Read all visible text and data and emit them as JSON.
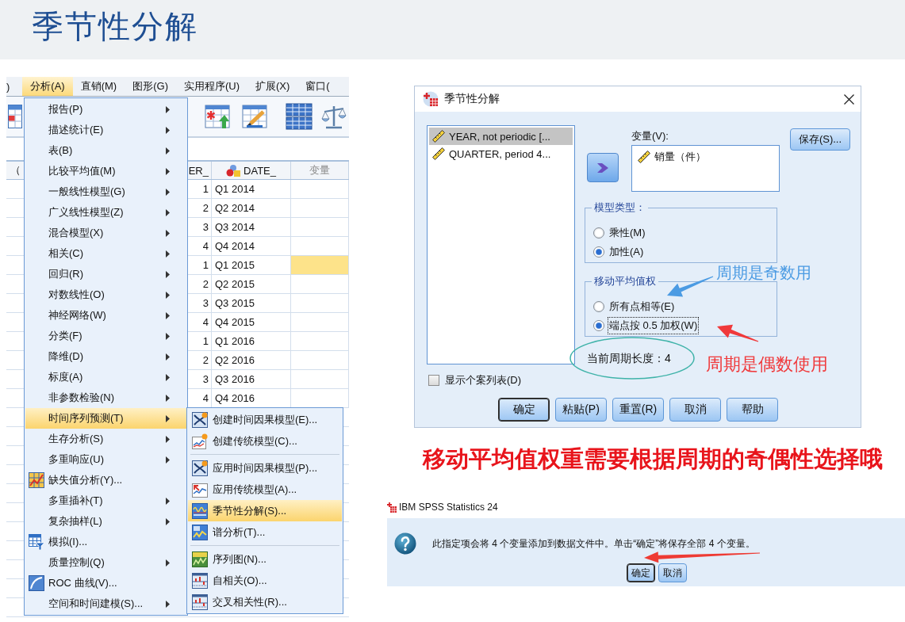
{
  "slide_title": "季节性分解",
  "spss_window": {
    "menu_bar": [
      {
        "label": ")",
        "selected": false
      },
      {
        "label": "分析(A)",
        "selected": true
      },
      {
        "label": "直销(M)",
        "selected": false
      },
      {
        "label": "图形(G)",
        "selected": false
      },
      {
        "label": "实用程序(U)",
        "selected": false
      },
      {
        "label": "扩展(X)",
        "selected": false
      },
      {
        "label": "窗口(",
        "selected": false
      }
    ],
    "grid": {
      "columns": [
        {
          "label": "（",
          "kind": "plain"
        },
        {
          "label": "ER_",
          "kind": "plain"
        },
        {
          "label": "DATE_",
          "kind": "nominal"
        },
        {
          "label": "变量",
          "kind": "empty"
        }
      ],
      "rows": [
        {
          "number": "1",
          "date": "Q1 2014",
          "selected": false
        },
        {
          "number": "2",
          "date": "Q2 2014",
          "selected": false
        },
        {
          "number": "3",
          "date": "Q3 2014",
          "selected": false
        },
        {
          "number": "4",
          "date": "Q4 2014",
          "selected": false
        },
        {
          "number": "1",
          "date": "Q1 2015",
          "selected": true
        },
        {
          "number": "2",
          "date": "Q2 2015",
          "selected": false
        },
        {
          "number": "3",
          "date": "Q3 2015",
          "selected": false
        },
        {
          "number": "4",
          "date": "Q4 2015",
          "selected": false
        },
        {
          "number": "1",
          "date": "Q1 2016",
          "selected": false
        },
        {
          "number": "2",
          "date": "Q2 2016",
          "selected": false
        },
        {
          "number": "3",
          "date": "Q3 2016",
          "selected": false
        },
        {
          "number": "4",
          "date": "Q4 2016",
          "selected": false
        }
      ]
    },
    "analyze_menu": [
      {
        "label": "报告(P)",
        "kind": "submenu",
        "selected": false
      },
      {
        "label": "描述统计(E)",
        "kind": "submenu",
        "selected": false
      },
      {
        "label": "表(B)",
        "kind": "submenu",
        "selected": false
      },
      {
        "label": "比较平均值(M)",
        "kind": "submenu",
        "selected": false
      },
      {
        "label": "一般线性模型(G)",
        "kind": "submenu",
        "selected": false
      },
      {
        "label": "广义线性模型(Z)",
        "kind": "submenu",
        "selected": false
      },
      {
        "label": "混合模型(X)",
        "kind": "submenu",
        "selected": false
      },
      {
        "label": "相关(C)",
        "kind": "submenu",
        "selected": false
      },
      {
        "label": "回归(R)",
        "kind": "submenu",
        "selected": false
      },
      {
        "label": "对数线性(O)",
        "kind": "submenu",
        "selected": false
      },
      {
        "label": "神经网络(W)",
        "kind": "submenu",
        "selected": false
      },
      {
        "label": "分类(F)",
        "kind": "submenu",
        "selected": false
      },
      {
        "label": "降维(D)",
        "kind": "submenu",
        "selected": false
      },
      {
        "label": "标度(A)",
        "kind": "submenu",
        "selected": false
      },
      {
        "label": "非参数检验(N)",
        "kind": "submenu",
        "selected": false
      },
      {
        "label": "时间序列预测(T)",
        "kind": "submenu",
        "selected": true
      },
      {
        "label": "生存分析(S)",
        "kind": "submenu",
        "selected": false
      },
      {
        "label": "多重响应(U)",
        "kind": "submenu",
        "selected": false
      },
      {
        "label": "缺失值分析(Y)...",
        "kind": "command",
        "selected": false
      },
      {
        "label": "多重插补(T)",
        "kind": "submenu",
        "selected": false
      },
      {
        "label": "复杂抽样(L)",
        "kind": "submenu",
        "selected": false
      },
      {
        "label": "模拟(I)...",
        "kind": "command",
        "selected": false
      },
      {
        "label": "质量控制(Q)",
        "kind": "submenu",
        "selected": false
      },
      {
        "label": "ROC 曲线(V)...",
        "kind": "command",
        "selected": false
      },
      {
        "label": "空间和时间建模(S)...",
        "kind": "submenu",
        "selected": false
      }
    ],
    "time_series_menu": [
      {
        "items": [
          {
            "label": "创建时间因果模型(E)...",
            "selected": false
          },
          {
            "label": "创建传统模型(C)...",
            "selected": false
          }
        ]
      },
      {
        "items": [
          {
            "label": "应用时间因果模型(P)...",
            "selected": false
          },
          {
            "label": "应用传统模型(A)...",
            "selected": false
          },
          {
            "label": "季节性分解(S)...",
            "selected": true
          },
          {
            "label": "谱分析(T)...",
            "selected": false
          }
        ]
      },
      {
        "items": [
          {
            "label": "序列图(N)...",
            "selected": false
          },
          {
            "label": "自相关(O)...",
            "selected": false
          },
          {
            "label": "交叉相关性(R)...",
            "selected": false
          }
        ]
      }
    ]
  },
  "seasonal_dialog": {
    "title": "季节性分解",
    "source_variables": [
      {
        "label": "YEAR, not periodic [...",
        "selected": true
      },
      {
        "label": "QUARTER, period 4...",
        "selected": false
      }
    ],
    "variables_label": "变量(V):",
    "variables": [
      "销量（件）"
    ],
    "save_button": "保存(S)...",
    "model_type": {
      "legend": "模型类型：",
      "options": [
        {
          "label": "乘性(M)",
          "selected": false,
          "focused": false
        },
        {
          "label": "加性(A)",
          "selected": true,
          "focused": false
        }
      ]
    },
    "moving_average_weight": {
      "legend": "移动平均值权",
      "options": [
        {
          "label": "所有点相等(E)",
          "selected": false,
          "focused": false
        },
        {
          "label": "端点按 0.5 加权(W)",
          "selected": true,
          "focused": true
        }
      ]
    },
    "period_length": "当前周期长度：4",
    "casewise_listing": {
      "label": "显示个案列表(D)",
      "checked": false
    },
    "buttons": [
      {
        "label": "确定",
        "focused": true
      },
      {
        "label": "粘贴(P)",
        "focused": false
      },
      {
        "label": "重置(R)",
        "focused": false
      },
      {
        "label": "取消",
        "focused": false
      },
      {
        "label": "帮助",
        "focused": false
      }
    ],
    "annotations": [
      {
        "text": "周期是奇数用",
        "color": "#4b9be3"
      },
      {
        "text": "周期是偶数使用",
        "color": "#f0393b"
      }
    ]
  },
  "caption": "移动平均值权重需要根据周期的奇偶性选择哦",
  "message_box": {
    "title": "IBM SPSS Statistics 24",
    "message": "此指定项会将 4 个变量添加到数据文件中。单击“确定”将保存全部 4 个变量。",
    "buttons": [
      {
        "label": "确定",
        "focused": true
      },
      {
        "label": "取消",
        "focused": false
      }
    ]
  }
}
